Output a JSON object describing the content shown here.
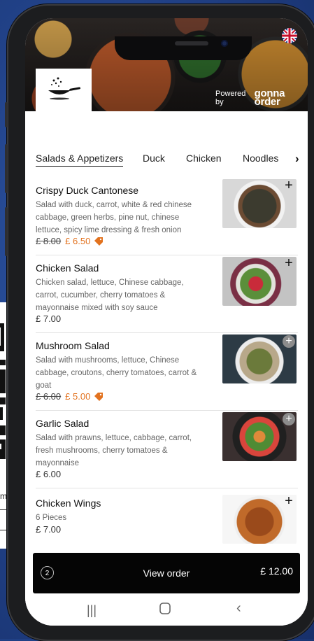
{
  "behind_card": {
    "url_fragment": "m"
  },
  "banner": {
    "powered_by": "Powered by",
    "brand": "gonna order"
  },
  "tabs": [
    "Salads & Appetizers",
    "Duck",
    "Chicken",
    "Noodles"
  ],
  "items": [
    {
      "name": "Crispy Duck Cantonese",
      "description": "Salad with duck, carrot, white & red chinese cabbage, green herbs, pine nut, chinese lettuce, spicy lime dressing & fresh onion",
      "old_price": "£ 8.00",
      "price": "£ 6.50",
      "discount": true
    },
    {
      "name": "Chicken Salad",
      "description": "Chicken salad, lettuce, Chinese cabbage, carrot, cucumber, cherry tomatoes & mayonnaise mixed with soy sauce",
      "price": "£ 7.00",
      "discount": false
    },
    {
      "name": "Mushroom Salad",
      "description": "Salad with mushrooms, lettuce, Chinese cabbage, croutons, cherry tomatoes, carrot & goat",
      "old_price": "£ 6.00",
      "price": "£ 5.00",
      "discount": true
    },
    {
      "name": "Garlic Salad",
      "description": "Salad with prawns, lettuce, cabbage, carrot, fresh mushrooms, cherry tomatoes & mayonnaise",
      "price": "£ 6.00",
      "discount": false
    },
    {
      "name": "Chicken Wings",
      "description": "6 Pieces",
      "price": "£ 7.00",
      "discount": false
    }
  ],
  "order_bar": {
    "count": "2",
    "label": "View order",
    "total": "£ 12.00"
  },
  "colors": {
    "accent": "#e2721f",
    "background": "#22438a"
  },
  "icons": [
    "uk-flag-icon",
    "wok-logo-icon",
    "chevron-right-icon",
    "add-icon",
    "price-tag-icon",
    "recents-icon",
    "home-icon",
    "back-icon"
  ]
}
